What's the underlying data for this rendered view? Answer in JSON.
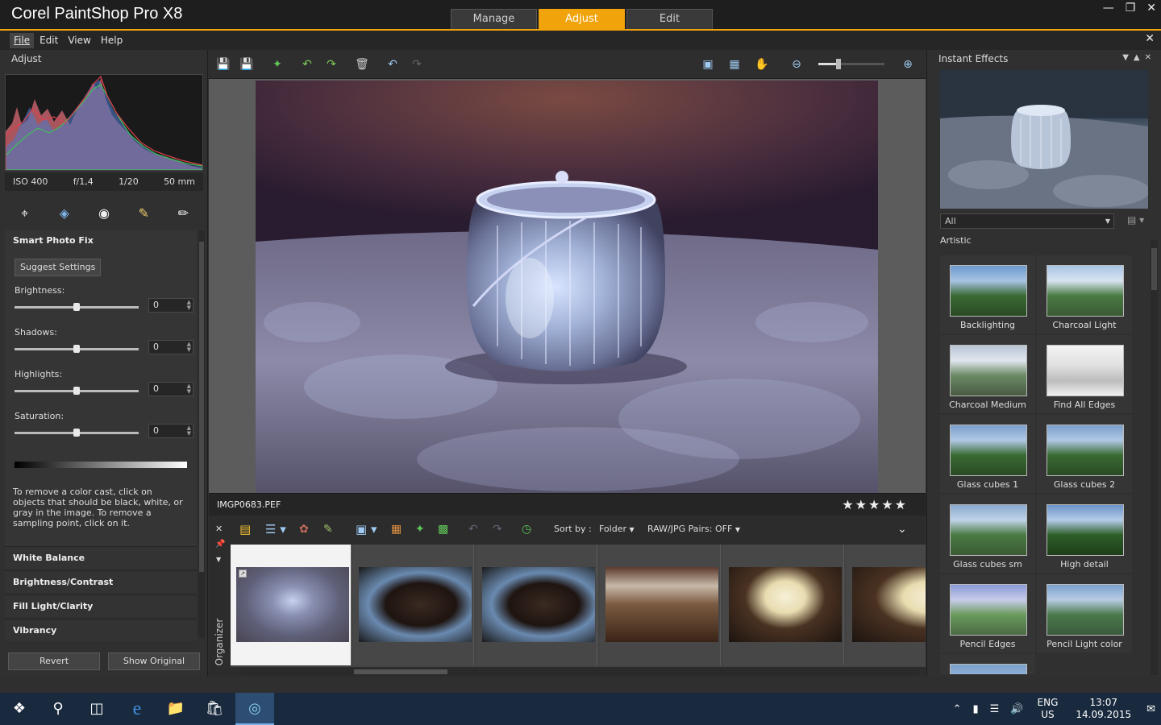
{
  "window": {
    "title": "Corel PaintShop Pro X8"
  },
  "workspace_tabs": [
    {
      "label": "Manage"
    },
    {
      "label": "Adjust"
    },
    {
      "label": "Edit"
    }
  ],
  "menu": {
    "items": [
      "File",
      "Edit",
      "View",
      "Help"
    ],
    "active": "File"
  },
  "left_panel": {
    "title": "Adjust",
    "exif": {
      "iso": "ISO 400",
      "aperture": "f/1,4",
      "shutter": "1/20",
      "focal": "50 mm"
    },
    "tools": [
      {
        "icon": "crop-icon"
      },
      {
        "icon": "straighten-icon"
      },
      {
        "icon": "red-eye-icon"
      },
      {
        "icon": "clone-brush-icon"
      },
      {
        "icon": "depth-of-field-icon"
      }
    ],
    "smart_photo_fix": {
      "title": "Smart Photo Fix",
      "suggest_button": "Suggest Settings",
      "sliders": [
        {
          "label": "Brightness:",
          "value": "0",
          "level": 0.5
        },
        {
          "label": "Shadows:",
          "value": "0",
          "level": 0.5
        },
        {
          "label": "Highlights:",
          "value": "0",
          "level": 0.5
        },
        {
          "label": "Saturation:",
          "value": "0",
          "level": 0.5
        }
      ],
      "help": "To remove a color cast, click on objects that should be black, white, or gray in the image. To remove a sampling point, click on it."
    },
    "sections": [
      "White Balance",
      "Brightness/Contrast",
      "Fill Light/Clarity",
      "Vibrancy"
    ],
    "revert_button": "Revert",
    "show_original_button": "Show Original"
  },
  "center": {
    "filename": "IMGP0683.PEF",
    "rating_stars": "★★★★★",
    "zoom_level": 0.3,
    "organizer": {
      "label": "Organizer",
      "sort_label": "Sort by :",
      "sort_value": "Folder",
      "raw_pairs": "RAW/JPG Pairs: OFF"
    }
  },
  "right_panel": {
    "title": "Instant Effects",
    "filter": "All",
    "category": "Artistic",
    "effects": [
      "Backlighting",
      "Charcoal Light",
      "Charcoal Medium",
      "Find All Edges",
      "Glass cubes 1",
      "Glass cubes 2",
      "Glass cubes sm",
      "High detail",
      "Pencil Edges",
      "Pencil Light color"
    ]
  },
  "taskbar": {
    "lang": "ENG",
    "region": "US",
    "time": "13:07",
    "date": "14.09.2015"
  },
  "colors": {
    "accent": "#f0a30a",
    "taskbar": "#1a2a3e"
  }
}
